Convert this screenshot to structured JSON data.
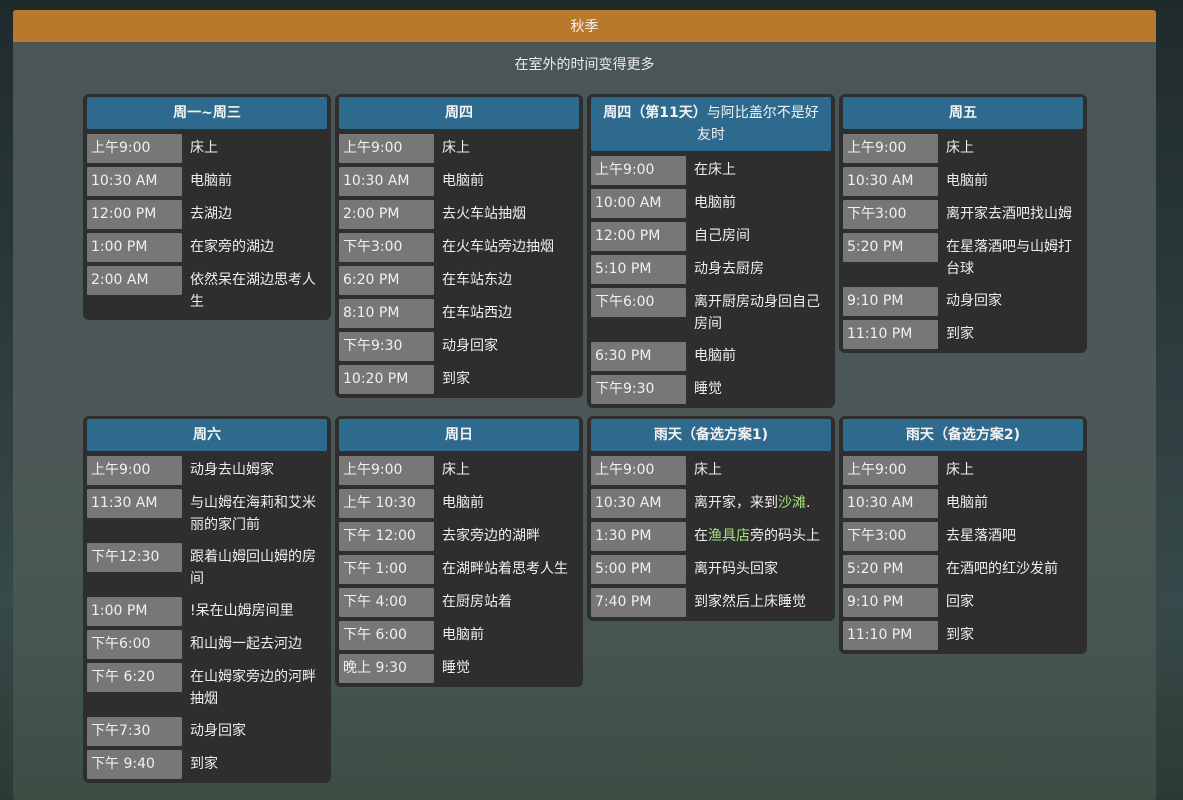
{
  "season": "秋季",
  "subtitle": "在室外的时间变得更多",
  "cards": [
    {
      "title": "周一~周三",
      "rows": [
        {
          "time": "上午9:00",
          "desc": "床上"
        },
        {
          "time": "10:30 AM",
          "desc": "电脑前"
        },
        {
          "time": "12:00 PM",
          "desc": "去湖边"
        },
        {
          "time": "1:00 PM",
          "desc": "在家旁的湖边"
        },
        {
          "time": "2:00 AM",
          "desc": "依然呆在湖边思考人生"
        }
      ]
    },
    {
      "title": "周四",
      "rows": [
        {
          "time": "上午9:00",
          "desc": "床上"
        },
        {
          "time": "10:30 AM",
          "desc": "电脑前"
        },
        {
          "time": "2:00 PM",
          "desc": "去火车站抽烟"
        },
        {
          "time": "下午3:00",
          "desc": "在火车站旁边抽烟"
        },
        {
          "time": "6:20 PM",
          "desc": "在车站东边"
        },
        {
          "time": "8:10 PM",
          "desc": "在车站西边"
        },
        {
          "time": "下午9:30",
          "desc": "动身回家"
        },
        {
          "time": "10:20 PM",
          "desc": "到家"
        }
      ]
    },
    {
      "title_bold": "周四（第11天）",
      "title_rest": "与阿比盖尔不是好友时",
      "rows": [
        {
          "time": "上午9:00",
          "desc": "在床上"
        },
        {
          "time": "10:00 AM",
          "desc": "电脑前"
        },
        {
          "time": "12:00 PM",
          "desc": "自己房间"
        },
        {
          "time": "5:10 PM",
          "desc": "动身去厨房"
        },
        {
          "time": "下午6:00",
          "desc": "离开厨房动身回自己房间"
        },
        {
          "time": "6:30 PM",
          "desc": "电脑前"
        },
        {
          "time": "下午9:30",
          "desc": "睡觉"
        }
      ]
    },
    {
      "title": "周五",
      "rows": [
        {
          "time": "上午9:00",
          "desc": "床上"
        },
        {
          "time": "10:30 AM",
          "desc": "电脑前"
        },
        {
          "time": "下午3:00",
          "desc": "离开家去酒吧找山姆"
        },
        {
          "time": "5:20 PM",
          "desc": "在星落酒吧与山姆打台球"
        },
        {
          "time": "9:10 PM",
          "desc": "动身回家"
        },
        {
          "time": "11:10 PM",
          "desc": "到家"
        }
      ]
    },
    {
      "title": "周六",
      "rows": [
        {
          "time": "上午9:00",
          "desc": "动身去山姆家"
        },
        {
          "time": "11:30 AM",
          "desc": "与山姆在海莉和艾米丽的家门前"
        },
        {
          "time": "下午12:30",
          "desc": "跟着山姆回山姆的房间"
        },
        {
          "time": "1:00 PM",
          "desc": "!呆在山姆房间里"
        },
        {
          "time": "下午6:00",
          "desc": "和山姆一起去河边"
        },
        {
          "time": "下午 6:20",
          "desc": "在山姆家旁边的河畔抽烟"
        },
        {
          "time": "下午7:30",
          "desc": "动身回家"
        },
        {
          "time": "下午 9:40",
          "desc": "到家"
        }
      ]
    },
    {
      "title": "周日",
      "rows": [
        {
          "time": "上午9:00",
          "desc": "床上"
        },
        {
          "time": "上午 10:30",
          "desc": "电脑前"
        },
        {
          "time": "下午 12:00",
          "desc": "去家旁边的湖畔"
        },
        {
          "time": "下午 1:00",
          "desc": "在湖畔站着思考人生"
        },
        {
          "time": "下午 4:00",
          "desc": "在厨房站着"
        },
        {
          "time": "下午 6:00",
          "desc": "电脑前"
        },
        {
          "time": "晚上 9:30",
          "desc": "睡觉"
        }
      ]
    },
    {
      "title": "雨天（备选方案1)",
      "rows": [
        {
          "time": "上午9:00",
          "desc": "床上"
        },
        {
          "time": "10:30 AM",
          "desc_pre": "离开家，来到",
          "desc_link": "沙滩",
          "desc_post": "."
        },
        {
          "time": "1:30 PM",
          "desc_pre": "在",
          "desc_link": "渔具店",
          "desc_post": "旁的码头上"
        },
        {
          "time": "5:00 PM",
          "desc": "离开码头回家"
        },
        {
          "time": "7:40 PM",
          "desc": "到家然后上床睡觉"
        }
      ]
    },
    {
      "title": "雨天（备选方案2)",
      "rows": [
        {
          "time": "上午9:00",
          "desc": "床上"
        },
        {
          "time": "10:30 AM",
          "desc": "电脑前"
        },
        {
          "time": "下午3:00",
          "desc": "去星落酒吧"
        },
        {
          "time": "5:20 PM",
          "desc": "在酒吧的红沙发前"
        },
        {
          "time": "9:10 PM",
          "desc": "回家"
        },
        {
          "time": "11:10 PM",
          "desc": "到家"
        }
      ]
    }
  ]
}
